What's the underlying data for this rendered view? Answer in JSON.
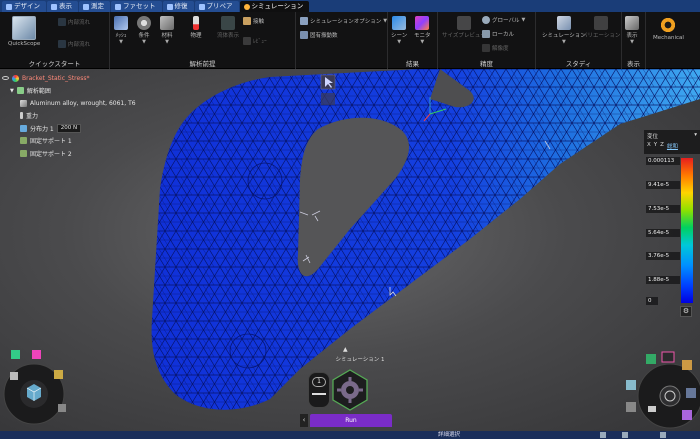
{
  "tabs": [
    {
      "label": "デザイン",
      "active": false
    },
    {
      "label": "表示",
      "active": false
    },
    {
      "label": "測定",
      "active": false
    },
    {
      "label": "ファセット",
      "active": false
    },
    {
      "label": "修復",
      "active": false
    },
    {
      "label": "プリペア",
      "active": false
    },
    {
      "label": "シミュレーション",
      "active": true
    }
  ],
  "ribbon": {
    "groups": {
      "quickstart": "クイックスタート",
      "analysis": "解析前提",
      "results": "結果",
      "accuracy": "精度",
      "study": "スタディ",
      "display": "表示"
    },
    "buttons": {
      "quickscope": "QuickScope",
      "inner_flow_1": "内部流れ",
      "inner_flow_2": "内部流れ",
      "mesh": "ﾒｯｼｭ",
      "conditions": "条件",
      "material": "材料",
      "physics": "物理",
      "display_flow": "流体表示",
      "rest_btn": "ﾚﾋﾞｭｰ",
      "contact": "接触",
      "sim_options": "シミュレーションオプション",
      "modes": "固有振動数",
      "scene": "シーン",
      "monitor": "モニタ",
      "size": "サイズプレビュー",
      "global": "グローバル",
      "local": "ローカル",
      "resolution": "解像度",
      "simulation": "シミュレーション",
      "variation": "バリエーション",
      "display": "表示",
      "mechanical": "Mechanical"
    }
  },
  "browser": {
    "file": "Bracket_Static_Stress*",
    "items": [
      {
        "label": "解析範囲"
      },
      {
        "label": "Aluminum alloy, wrought, 6061, T6"
      },
      {
        "label": "重力"
      },
      {
        "label": "分布力 1",
        "value": "200 N"
      },
      {
        "label": "固定サポート 1"
      },
      {
        "label": "固定サポート 2"
      }
    ]
  },
  "legend": {
    "title": "変位",
    "axes": [
      "X",
      "Y",
      "Z",
      "総和"
    ],
    "values": [
      "0.000113",
      "9.41e-5",
      "7.53e-5",
      "5.64e-5",
      "3.76e-5",
      "1.88e-5",
      "0"
    ]
  },
  "hud": {
    "simulation_label": "シミュレーション 1",
    "step": "1",
    "study_button": "Run"
  },
  "status": {
    "text": "詳細選択"
  },
  "colors": {
    "accent": "#7a2cc8",
    "tabbar": "#1a3d78",
    "mesh_deep": "#1030d8",
    "mesh_mid": "#1e6fe0",
    "mesh_light": "#3fa8f0"
  }
}
